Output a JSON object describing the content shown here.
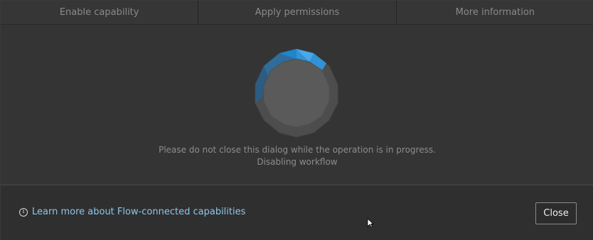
{
  "tabs": [
    {
      "label": "Enable capability"
    },
    {
      "label": "Apply permissions"
    },
    {
      "label": "More information"
    }
  ],
  "progress": {
    "message_line1": "Please do not close this dialog while the operation is in progress.",
    "message_line2": "Disabling workflow"
  },
  "footer": {
    "learn_more_label": "Learn more about Flow-connected capabilities",
    "close_label": "Close"
  },
  "colors": {
    "accent": "#1b8bd3",
    "link": "#8dc6ea"
  },
  "icons": {
    "info": "info-icon",
    "spinner": "loading-spinner-icon",
    "cursor": "mouse-cursor-icon"
  }
}
